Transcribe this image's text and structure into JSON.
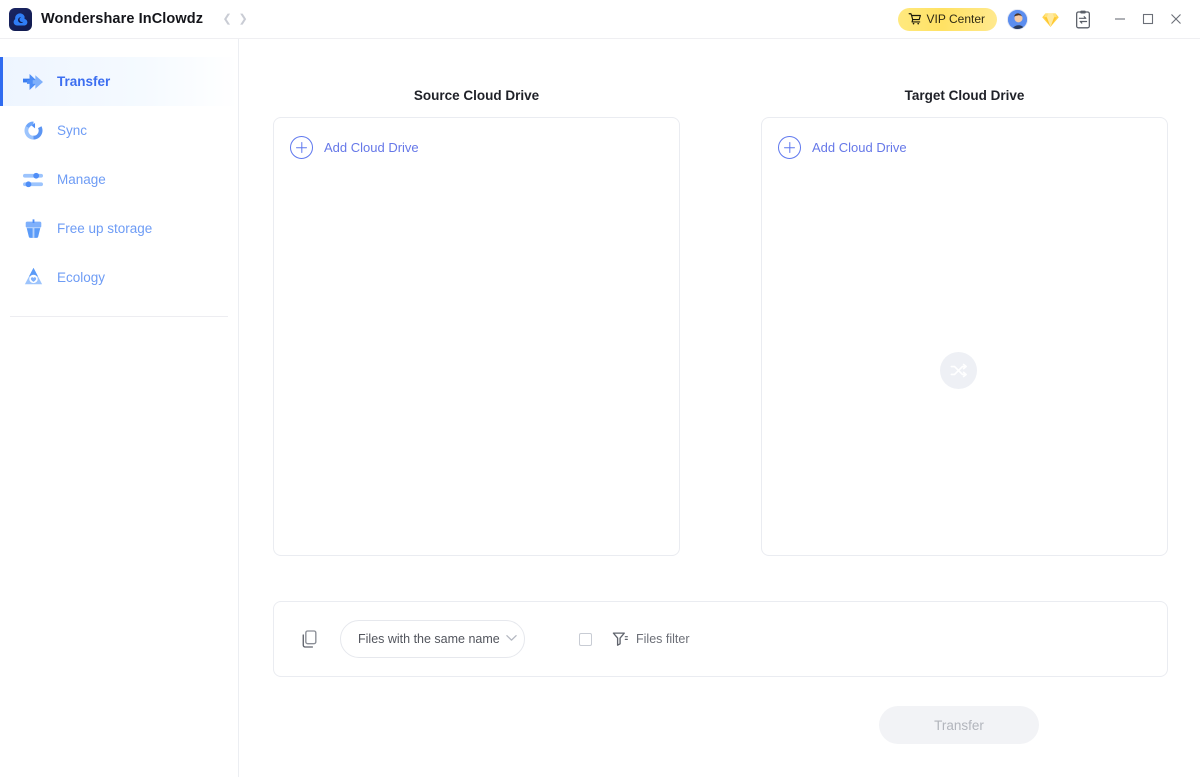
{
  "window": {
    "app_title": "Wondershare InClowdz",
    "logo_icon": "cloud-logo-icon",
    "nav_back_icon": "chevron-left-icon",
    "nav_forward_icon": "chevron-right-icon",
    "vip_button_label": "VIP Center",
    "vip_cart_icon": "shopping-cart-icon",
    "avatar_icon": "user-avatar",
    "gem_icon": "diamond-gem-icon",
    "tasks_icon": "clipboard-transfer-icon",
    "minimize_icon": "minimize-icon",
    "maximize_icon": "maximize-icon",
    "close_icon": "close-icon",
    "accent_color": "#2f6bf0",
    "vip_gradient_start": "#ffe97f",
    "vip_gradient_end": "#ffe98e"
  },
  "sidebar": {
    "items": [
      {
        "label": "Transfer",
        "icon": "transfer-arrows-icon",
        "active": true
      },
      {
        "label": "Sync",
        "icon": "sync-circular-icon",
        "active": false
      },
      {
        "label": "Manage",
        "icon": "manage-sliders-icon",
        "active": false
      },
      {
        "label": "Free up storage",
        "icon": "broom-cleanup-icon",
        "active": false
      },
      {
        "label": "Ecology",
        "icon": "ecology-leaf-icon",
        "active": false
      }
    ]
  },
  "main": {
    "source_panel": {
      "title": "Source Cloud Drive",
      "add_label": "Add Cloud Drive",
      "add_icon": "plus-circle-icon"
    },
    "target_panel": {
      "title": "Target Cloud Drive",
      "add_label": "Add Cloud Drive",
      "add_icon": "plus-circle-icon"
    },
    "swap_icon": "swap-shuffle-icon",
    "filter_bar": {
      "copy_icon": "copy-files-icon",
      "duplicate_select_value": "Files with the same name",
      "duplicate_select_chevron": "chevron-down-icon",
      "files_filter_checked": false,
      "files_filter_icon": "funnel-filter-icon",
      "files_filter_label": "Files filter"
    },
    "transfer_button": {
      "label": "Transfer",
      "disabled": true
    },
    "illustration_icon": "notepad-pencil-illustration"
  }
}
